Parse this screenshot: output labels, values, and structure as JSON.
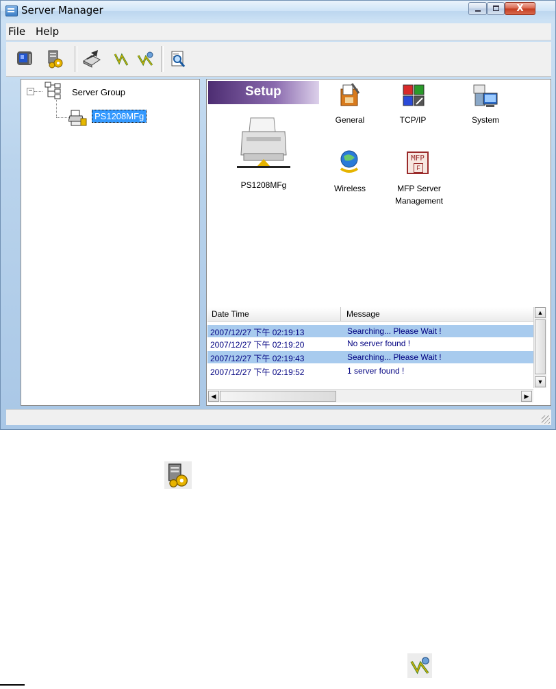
{
  "window": {
    "title": "Server Manager",
    "close_glyph": "X"
  },
  "menu": {
    "file": "File",
    "help": "Help"
  },
  "toolbar": {
    "buttons": [
      "monitor-icon",
      "server-settings-icon",
      "printer-setup-icon",
      "upgrade-icon",
      "reset-icon",
      "search-icon"
    ]
  },
  "tree": {
    "expander": "−",
    "root": "Server Group",
    "child": "PS1208MFg"
  },
  "setup": {
    "banner": "Setup",
    "device": "PS1208MFg",
    "items": [
      {
        "label": "General",
        "icon": "general-tools-icon"
      },
      {
        "label": "TCP/IP",
        "icon": "tcpip-icon"
      },
      {
        "label": "System",
        "icon": "system-icon"
      },
      {
        "label": "Wireless",
        "icon": "wireless-icon"
      },
      {
        "label1": "MFP Server",
        "label2": "Management",
        "icon": "mfp-icon",
        "icon_text_top": "MFP",
        "icon_text_bottom": "F"
      }
    ]
  },
  "log": {
    "col_datetime": "Date Time",
    "col_message": "Message",
    "rows": [
      {
        "datetime": "2007/12/27 下午 02:19:13",
        "message": "Searching... Please Wait !",
        "highlight": true
      },
      {
        "datetime": "2007/12/27 下午 02:19:20",
        "message": "No server found !",
        "highlight": false
      },
      {
        "datetime": "2007/12/27 下午 02:19:43",
        "message": "Searching... Please Wait !",
        "highlight": true
      },
      {
        "datetime": "2007/12/27 下午 02:19:52",
        "message": "1 server found !",
        "highlight": false
      }
    ]
  },
  "colors": {
    "selection": "#3399ff",
    "log_highlight": "#a8cbee",
    "log_text": "#000080",
    "setup_banner": "#6a4a8e"
  }
}
